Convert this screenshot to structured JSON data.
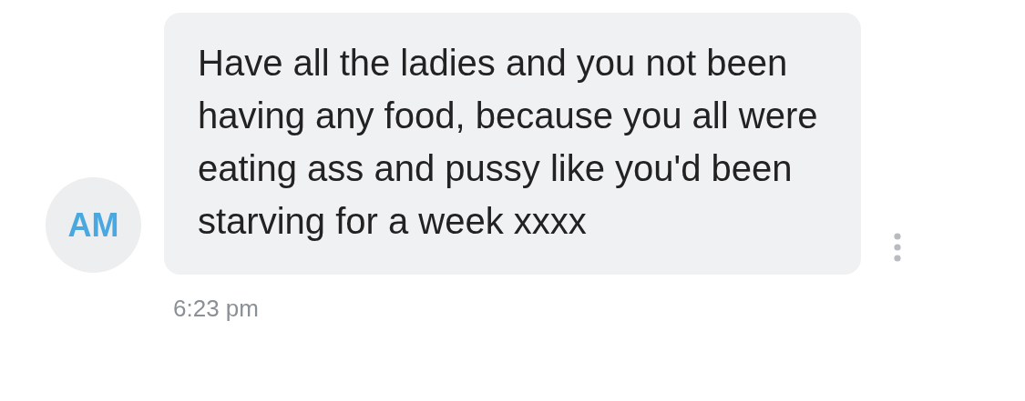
{
  "message": {
    "avatar_initials": "AM",
    "text": "Have all the ladies and you not been having any food, because you all were eating ass and pussy like you'd been starving for a week xxxx",
    "time": "6:23 pm"
  }
}
